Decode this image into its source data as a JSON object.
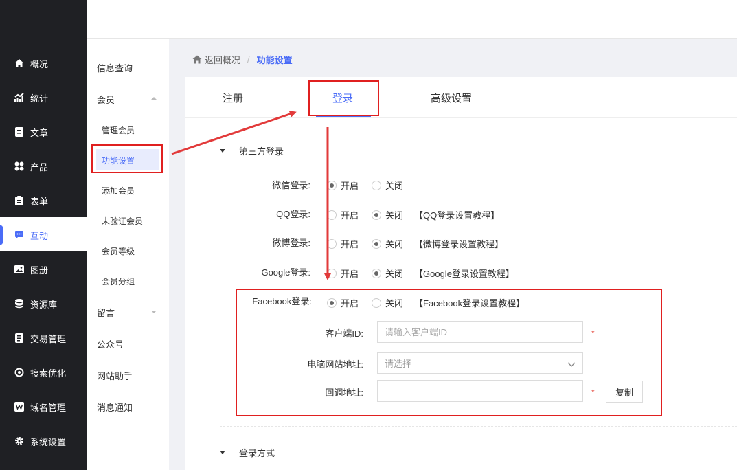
{
  "sidebar": {
    "items": [
      {
        "label": "概况",
        "icon": "home-icon"
      },
      {
        "label": "统计",
        "icon": "chart-icon"
      },
      {
        "label": "文章",
        "icon": "article-icon"
      },
      {
        "label": "产品",
        "icon": "grid-icon"
      },
      {
        "label": "表单",
        "icon": "clipboard-icon"
      },
      {
        "label": "互动",
        "icon": "chat-icon",
        "active": true
      },
      {
        "label": "图册",
        "icon": "album-icon"
      },
      {
        "label": "资源库",
        "icon": "database-icon"
      },
      {
        "label": "交易管理",
        "icon": "order-icon"
      },
      {
        "label": "搜索优化",
        "icon": "seo-icon"
      },
      {
        "label": "域名管理",
        "icon": "domain-icon"
      },
      {
        "label": "系统设置",
        "icon": "gear-icon"
      }
    ]
  },
  "subnav": {
    "info_query": "信息查询",
    "member": "会员",
    "member_children": [
      "管理会员",
      "功能设置",
      "添加会员",
      "未验证会员",
      "会员等级",
      "会员分组"
    ],
    "message": "留言",
    "wechat_official": "公众号",
    "site_assistant": "网站助手",
    "notifications": "消息通知"
  },
  "breadcrumb": {
    "back": "返回概况",
    "separator": "/",
    "current": "功能设置"
  },
  "tabs": [
    "注册",
    "登录",
    "高级设置"
  ],
  "sections": {
    "third_party": "第三方登录",
    "login_method": "登录方式"
  },
  "login_rows": [
    {
      "label": "微信登录:",
      "on": "开启",
      "off": "关闭",
      "selected": "on",
      "tutorial": ""
    },
    {
      "label": "QQ登录:",
      "on": "开启",
      "off": "关闭",
      "selected": "off",
      "tutorial": "【QQ登录设置教程】"
    },
    {
      "label": "微博登录:",
      "on": "开启",
      "off": "关闭",
      "selected": "off",
      "tutorial": "【微博登录设置教程】"
    },
    {
      "label": "Google登录:",
      "on": "开启",
      "off": "关闭",
      "selected": "off",
      "tutorial": "【Google登录设置教程】"
    },
    {
      "label": "Facebook登录:",
      "on": "开启",
      "off": "关闭",
      "selected": "on",
      "tutorial": "【Facebook登录设置教程】"
    }
  ],
  "facebook_form": {
    "client_id_label": "客户端ID:",
    "client_id_placeholder": "请输入客户端ID",
    "site_url_label": "电脑网站地址:",
    "site_url_placeholder": "请选择",
    "callback_label": "回调地址:",
    "callback_value": "",
    "required_mark": "*",
    "copy_button": "复制"
  },
  "colors": {
    "accent": "#4a6cf7",
    "sidebar_bg": "#1f2024",
    "annotation_red": "#e02020"
  }
}
